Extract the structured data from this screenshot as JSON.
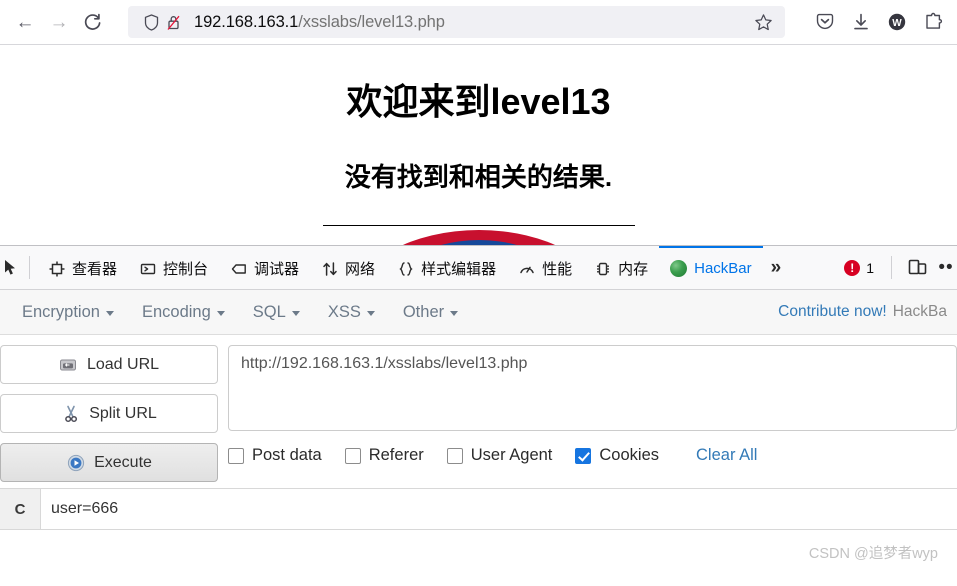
{
  "browser": {
    "nav": {
      "back_icon": "arrow-left-icon",
      "forward_icon": "arrow-right-icon",
      "reload_icon": "reload-icon"
    },
    "urlbar": {
      "shield_icon": "shield-icon",
      "insecure_icon": "lock-crossed-icon",
      "url_host": "192.168.163.1",
      "url_path": "/xsslabs/level13.php",
      "bookmark_icon": "star-icon"
    },
    "extensions": [
      {
        "name": "pocket-icon",
        "label": "Pocket"
      },
      {
        "name": "download-icon",
        "label": "Downloads"
      },
      {
        "name": "wappalyzer-icon",
        "label": "W"
      },
      {
        "name": "extensions-puzzle-icon",
        "label": "Extensions"
      }
    ]
  },
  "page": {
    "welcome_heading": "欢迎来到level13",
    "result_heading": "没有找到和相关的结果.",
    "logo_name": "site-logo-image"
  },
  "devtools": {
    "picker_icon": "element-picker-icon",
    "tabs": [
      {
        "label": "查看器",
        "icon": "inspector-icon",
        "active": false
      },
      {
        "label": "控制台",
        "icon": "console-icon",
        "active": false
      },
      {
        "label": "调试器",
        "icon": "debugger-icon",
        "active": false
      },
      {
        "label": "网络",
        "icon": "network-icon",
        "active": false
      },
      {
        "label": "样式编辑器",
        "icon": "style-editor-icon",
        "active": false
      },
      {
        "label": "性能",
        "icon": "performance-icon",
        "active": false
      },
      {
        "label": "内存",
        "icon": "memory-icon",
        "active": false
      },
      {
        "label": "HackBar",
        "icon": "hackbar-icon",
        "active": true
      }
    ],
    "overflow_label": "»",
    "error_count": "1",
    "error_icon": "error-circle-icon",
    "responsive_icon": "responsive-design-mode-icon",
    "meatball_label": "••"
  },
  "hackbar": {
    "menu": [
      {
        "label": "Encryption"
      },
      {
        "label": "Encoding"
      },
      {
        "label": "SQL"
      },
      {
        "label": "XSS"
      },
      {
        "label": "Other"
      }
    ],
    "contribute_label": "Contribute now!",
    "version_label": "HackBa",
    "buttons": [
      {
        "label": "Load URL",
        "icon": "load-url-icon",
        "pressed": false
      },
      {
        "label": "Split URL",
        "icon": "split-url-scissors-icon",
        "pressed": false
      },
      {
        "label": "Execute",
        "icon": "execute-play-icon",
        "pressed": true
      }
    ],
    "url_value": "http://192.168.163.1/xsslabs/level13.php",
    "options": [
      {
        "label": "Post data",
        "checked": false
      },
      {
        "label": "Referer",
        "checked": false
      },
      {
        "label": "User Agent",
        "checked": false
      },
      {
        "label": "Cookies",
        "checked": true
      }
    ],
    "clear_all_label": "Clear All",
    "cookie_label": "C",
    "cookie_value": "user=666"
  },
  "watermark": "CSDN @追梦者wyp",
  "colors": {
    "accent_blue": "#0074e8",
    "link_blue": "#337ab7",
    "checkbox_blue": "#1675e0",
    "error_red": "#d70022",
    "logo_red": "#c8102e",
    "logo_blue": "#16499a"
  }
}
